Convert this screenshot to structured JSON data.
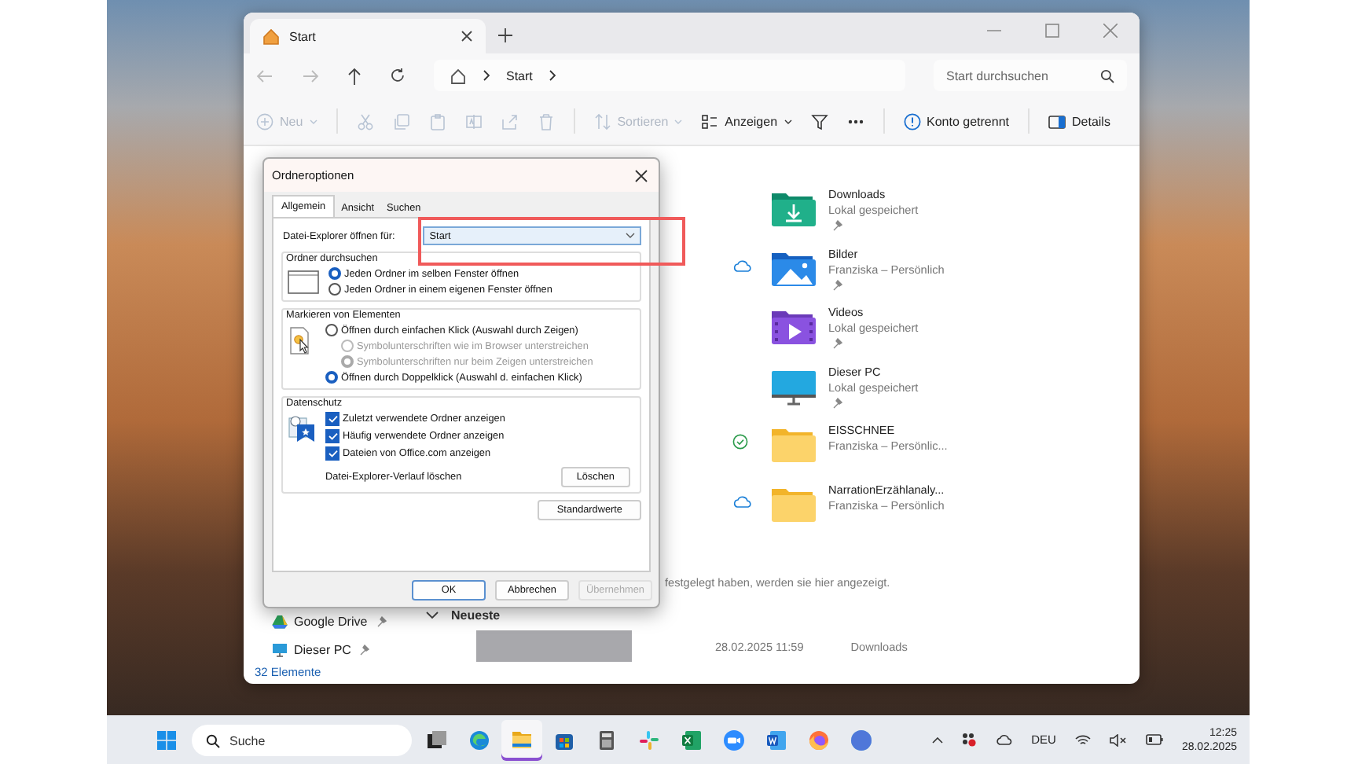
{
  "explorer": {
    "tab": {
      "title": "Start",
      "selected": true
    },
    "breadcrumb": [
      "Start"
    ],
    "search": {
      "placeholder": "Start durchsuchen"
    },
    "toolbar": [
      {
        "kind": "new",
        "label": "Neu",
        "disabled": true
      },
      {
        "kind": "cut",
        "disabled": true
      },
      {
        "kind": "copy",
        "disabled": true
      },
      {
        "kind": "paste",
        "disabled": true
      },
      {
        "kind": "rename",
        "disabled": true
      },
      {
        "kind": "share",
        "disabled": true
      },
      {
        "kind": "delete",
        "disabled": true
      },
      {
        "kind": "sort",
        "label": "Sortieren",
        "disabled": true
      },
      {
        "kind": "view",
        "label": "Anzeigen",
        "disabled": false
      },
      {
        "kind": "filter",
        "disabled": false
      },
      {
        "kind": "more",
        "disabled": false
      },
      {
        "kind": "account",
        "label": "Konto getrennt",
        "disabled": false
      },
      {
        "kind": "details",
        "label": "Details",
        "disabled": false
      }
    ],
    "sidebar": [
      {
        "label": "Google Drive",
        "kind": "drive",
        "pinned": true
      },
      {
        "label": "Dieser PC",
        "kind": "pc",
        "pinned": true
      }
    ],
    "quick_access": [
      {
        "name": "Downloads",
        "location": "Lokal gespeichert",
        "kind": "downloads",
        "cloud": false,
        "synced": false,
        "pinned": true
      },
      {
        "name": "Bilder",
        "location": "Franziska – Persönlich",
        "kind": "pictures",
        "cloud": true,
        "synced": false,
        "pinned": true
      },
      {
        "name": "Videos",
        "location": "Lokal gespeichert",
        "kind": "videos",
        "cloud": false,
        "synced": false,
        "pinned": true
      },
      {
        "name": "Dieser PC",
        "location": "Lokal gespeichert",
        "kind": "pc",
        "cloud": false,
        "synced": false,
        "pinned": true
      },
      {
        "name": "EISSCHNEE",
        "location": "Franziska – Persönlic...",
        "kind": "folder",
        "cloud": false,
        "synced": true,
        "pinned": false
      },
      {
        "name": "NarrationErzählanaly...",
        "location": "Franziska – Persönlich",
        "kind": "folder",
        "cloud": true,
        "synced": false,
        "pinned": false
      }
    ],
    "favorites_hint": "festgelegt haben, werden sie hier angezeigt.",
    "recent": {
      "heading": "Neueste",
      "expanded": true,
      "rows": [
        {
          "date": "28.02.2025 11:59",
          "location": "Downloads"
        }
      ]
    },
    "status_bar": "32 Elemente"
  },
  "dialog": {
    "title": "Ordneroptionen",
    "tabs": [
      {
        "label": "Allgemein",
        "selected": true
      },
      {
        "label": "Ansicht",
        "selected": false
      },
      {
        "label": "Suchen",
        "selected": false
      }
    ],
    "open_for": {
      "label": "Datei-Explorer öffnen für:",
      "value": "Start",
      "highlighted": true
    },
    "groups": [
      {
        "title": "Ordner durchsuchen",
        "kind": "window",
        "options": [
          {
            "kind": "radio",
            "label": "Jeden Ordner im selben Fenster öffnen",
            "selected": true,
            "disabled": false,
            "indented": false
          },
          {
            "kind": "radio",
            "label": "Jeden Ordner in einem eigenen Fenster öffnen",
            "selected": false,
            "disabled": false,
            "indented": false
          }
        ]
      },
      {
        "title": "Markieren von Elementen",
        "kind": "click",
        "options": [
          {
            "kind": "radio",
            "label": "Öffnen durch einfachen Klick (Auswahl durch Zeigen)",
            "selected": false,
            "disabled": false,
            "indented": false
          },
          {
            "kind": "radio",
            "label": "Symbolunterschriften wie im Browser unterstreichen",
            "selected": false,
            "disabled": true,
            "indented": true
          },
          {
            "kind": "radio",
            "label": "Symbolunterschriften nur beim Zeigen unterstreichen",
            "selected": true,
            "disabled": true,
            "indented": true
          },
          {
            "kind": "radio",
            "label": "Öffnen durch Doppelklick (Auswahl d. einfachen Klick)",
            "selected": true,
            "disabled": false,
            "indented": false
          }
        ]
      },
      {
        "title": "Datenschutz",
        "kind": "privacy",
        "options": [
          {
            "kind": "checkbox",
            "label": "Zuletzt verwendete Ordner anzeigen",
            "checked": true
          },
          {
            "kind": "checkbox",
            "label": "Häufig verwendete Ordner anzeigen",
            "checked": true
          },
          {
            "kind": "checkbox",
            "label": "Dateien von Office.com anzeigen",
            "checked": true
          },
          {
            "kind": "action",
            "label": "Datei-Explorer-Verlauf löschen",
            "button": "Löschen"
          }
        ]
      }
    ],
    "defaults_button": "Standardwerte",
    "buttons": [
      {
        "label": "OK",
        "kind": "default",
        "disabled": false
      },
      {
        "label": "Abbrechen",
        "kind": "normal",
        "disabled": false
      },
      {
        "label": "Übernehmen",
        "kind": "normal",
        "disabled": true
      }
    ]
  },
  "taskbar": {
    "search": {
      "placeholder": "Suche"
    },
    "apps": [
      {
        "kind": "taskview",
        "active": false
      },
      {
        "kind": "edge",
        "active": false
      },
      {
        "kind": "explorer",
        "active": true
      },
      {
        "kind": "store",
        "active": false
      },
      {
        "kind": "calculator",
        "active": false
      },
      {
        "kind": "slack",
        "active": false
      },
      {
        "kind": "excel",
        "active": false
      },
      {
        "kind": "zoom",
        "active": false
      },
      {
        "kind": "word",
        "active": false
      },
      {
        "kind": "firefox",
        "active": false
      },
      {
        "kind": "canva",
        "active": false
      }
    ],
    "language": "DEU",
    "time": "12:25",
    "date": "28.02.2025"
  }
}
